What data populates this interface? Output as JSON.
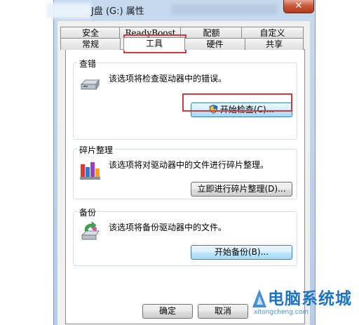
{
  "window": {
    "title": "J盘 (G:) 属性",
    "close": "✕"
  },
  "tabs": {
    "row1": [
      "安全",
      "ReadyBoost",
      "配额",
      "自定义"
    ],
    "row2": [
      "常规",
      "工具",
      "硬件",
      "共享"
    ]
  },
  "groups": {
    "check": {
      "legend": "查错",
      "desc": "该选项将检查驱动器中的错误。",
      "button": "开始检查(C)..."
    },
    "defrag": {
      "legend": "碎片整理",
      "desc": "该选项将对驱动器中的文件进行碎片整理。",
      "button": "立即进行碎片整理(D)..."
    },
    "backup": {
      "legend": "备份",
      "desc": "该选项将备份驱动器中的文件。",
      "button": "开始备份(B)..."
    }
  },
  "footer": {
    "ok": "确定",
    "cancel": "取消"
  },
  "watermark": {
    "text": "电脑系统城",
    "sub": "xitongcheng.com"
  }
}
